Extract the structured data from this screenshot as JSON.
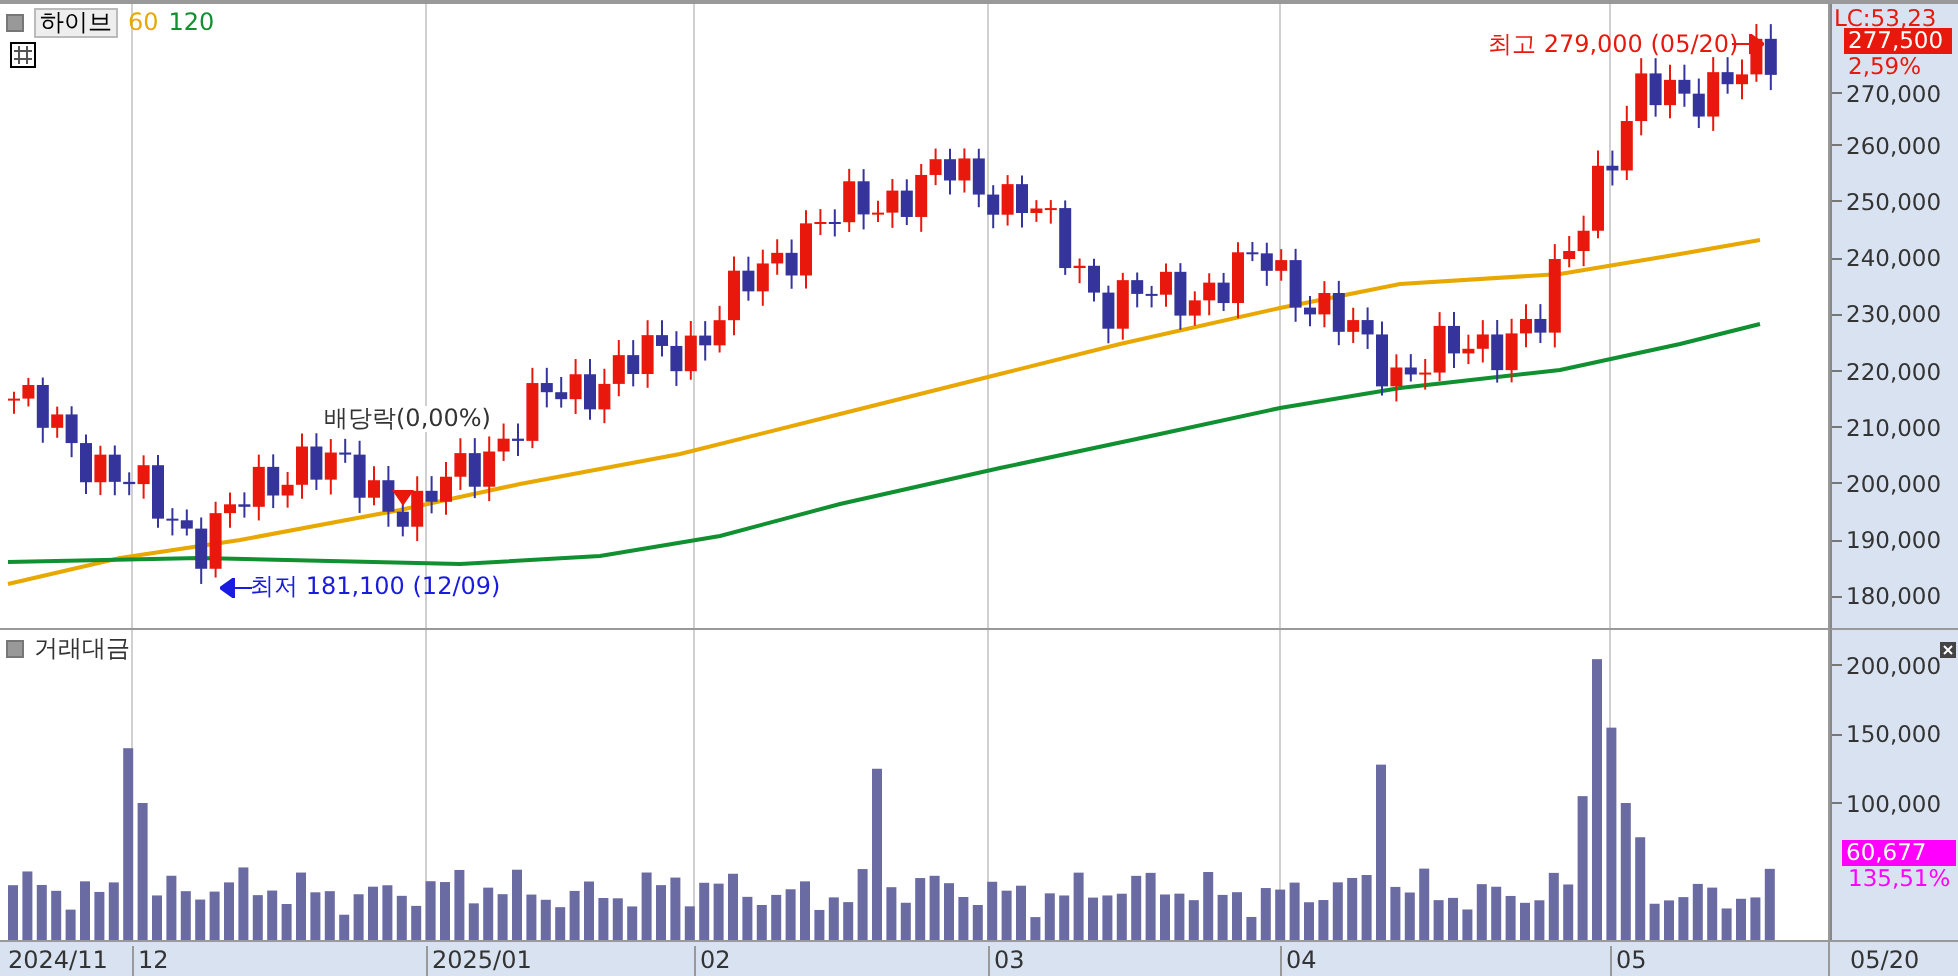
{
  "instrument": {
    "name": "하이브",
    "ma_labels": [
      {
        "label": "60",
        "color": "#e8a800"
      },
      {
        "label": "120",
        "color": "#109030"
      }
    ]
  },
  "price_axis": {
    "indicator": "LC:53,23",
    "current_price": "277,500",
    "change": "2,59%",
    "ticks": [
      "270,000",
      "260,000",
      "250,000",
      "240,000",
      "230,000",
      "220,000",
      "210,000",
      "200,000",
      "190,000",
      "180,000"
    ]
  },
  "annotations": [
    {
      "kind": "high",
      "text": "최고 279,000 (05/20)"
    },
    {
      "kind": "dividend",
      "text": "배당락(0,00%)"
    },
    {
      "kind": "low",
      "text": "최저 181,100 (12/09)"
    }
  ],
  "volume_pane": {
    "title": "거래대금",
    "ticks": [
      "200,000",
      "150,000",
      "100,000"
    ],
    "current_value": "60,677",
    "change": "135,51%"
  },
  "x_axis": {
    "labels": [
      "2024/11",
      "12",
      "2025/01",
      "02",
      "03",
      "04",
      "05"
    ],
    "cursor_label": "05/20"
  }
}
